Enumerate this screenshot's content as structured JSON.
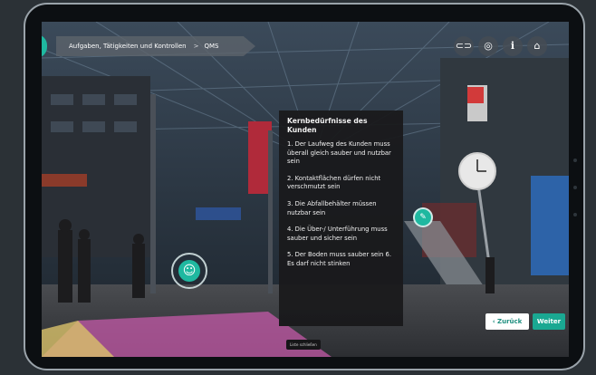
{
  "breadcrumb": {
    "section": "Aufgaben, Tätigkeiten und Kontrollen",
    "separator": ">",
    "current": "QMS"
  },
  "top_icons": [
    {
      "name": "link-icon",
      "glyph": "⊂⊃"
    },
    {
      "name": "eye-off-icon",
      "glyph": "◎"
    },
    {
      "name": "info-icon",
      "glyph": "i"
    },
    {
      "name": "home-icon",
      "glyph": "⌂"
    }
  ],
  "panel": {
    "title": "Kernbedürfnisse des Kunden",
    "items": [
      "1. Der Laufweg des Kunden muss überall gleich sauber und nutzbar sein",
      "2. Kontaktflächen dürfen nicht verschmutzt sein",
      "3. Die Abfallbehälter müssen nutzbar sein",
      "4. Die Über-/ Unterführung muss sauber und sicher sein",
      "5. Der Boden muss sauber sein 6. Es darf nicht stinken"
    ],
    "close_label": "Liste schließen"
  },
  "hotspots": {
    "face_glyph": "☺",
    "small_glyph": "✎"
  },
  "nav": {
    "back_label": "‹ Zurück",
    "next_label": "Weiter"
  },
  "colors": {
    "accent": "#1fb8a0",
    "panel_bg": "#1a1a1c",
    "frame": "#9aa3aa",
    "background": "#2b3136"
  }
}
